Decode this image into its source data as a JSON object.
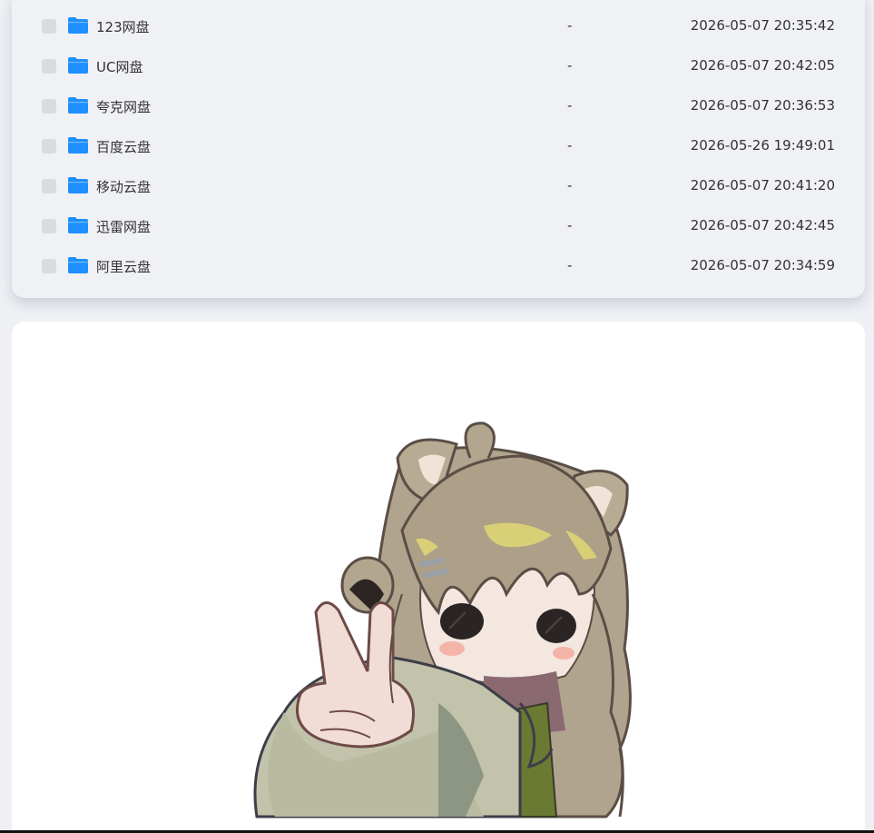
{
  "files": [
    {
      "name": "123网盘",
      "size": "-",
      "modified": "2026-05-07 20:35:42",
      "icon": "folder-icon"
    },
    {
      "name": "UC网盘",
      "size": "-",
      "modified": "2026-05-07 20:42:05",
      "icon": "folder-icon"
    },
    {
      "name": "夸克网盘",
      "size": "-",
      "modified": "2026-05-07 20:36:53",
      "icon": "folder-icon"
    },
    {
      "name": "百度云盘",
      "size": "-",
      "modified": "2026-05-26 19:49:01",
      "icon": "folder-icon"
    },
    {
      "name": "移动云盘",
      "size": "-",
      "modified": "2026-05-07 20:41:20",
      "icon": "folder-icon"
    },
    {
      "name": "迅雷网盘",
      "size": "-",
      "modified": "2026-05-07 20:42:45",
      "icon": "folder-icon"
    },
    {
      "name": "阿里云盘",
      "size": "-",
      "modified": "2026-05-07 20:34:59",
      "icon": "folder-icon"
    }
  ],
  "colors": {
    "folder": "#1e90ff",
    "checkbox": "#d9dbe0",
    "card_bg": "#f0f1f5",
    "text": "#333333"
  }
}
